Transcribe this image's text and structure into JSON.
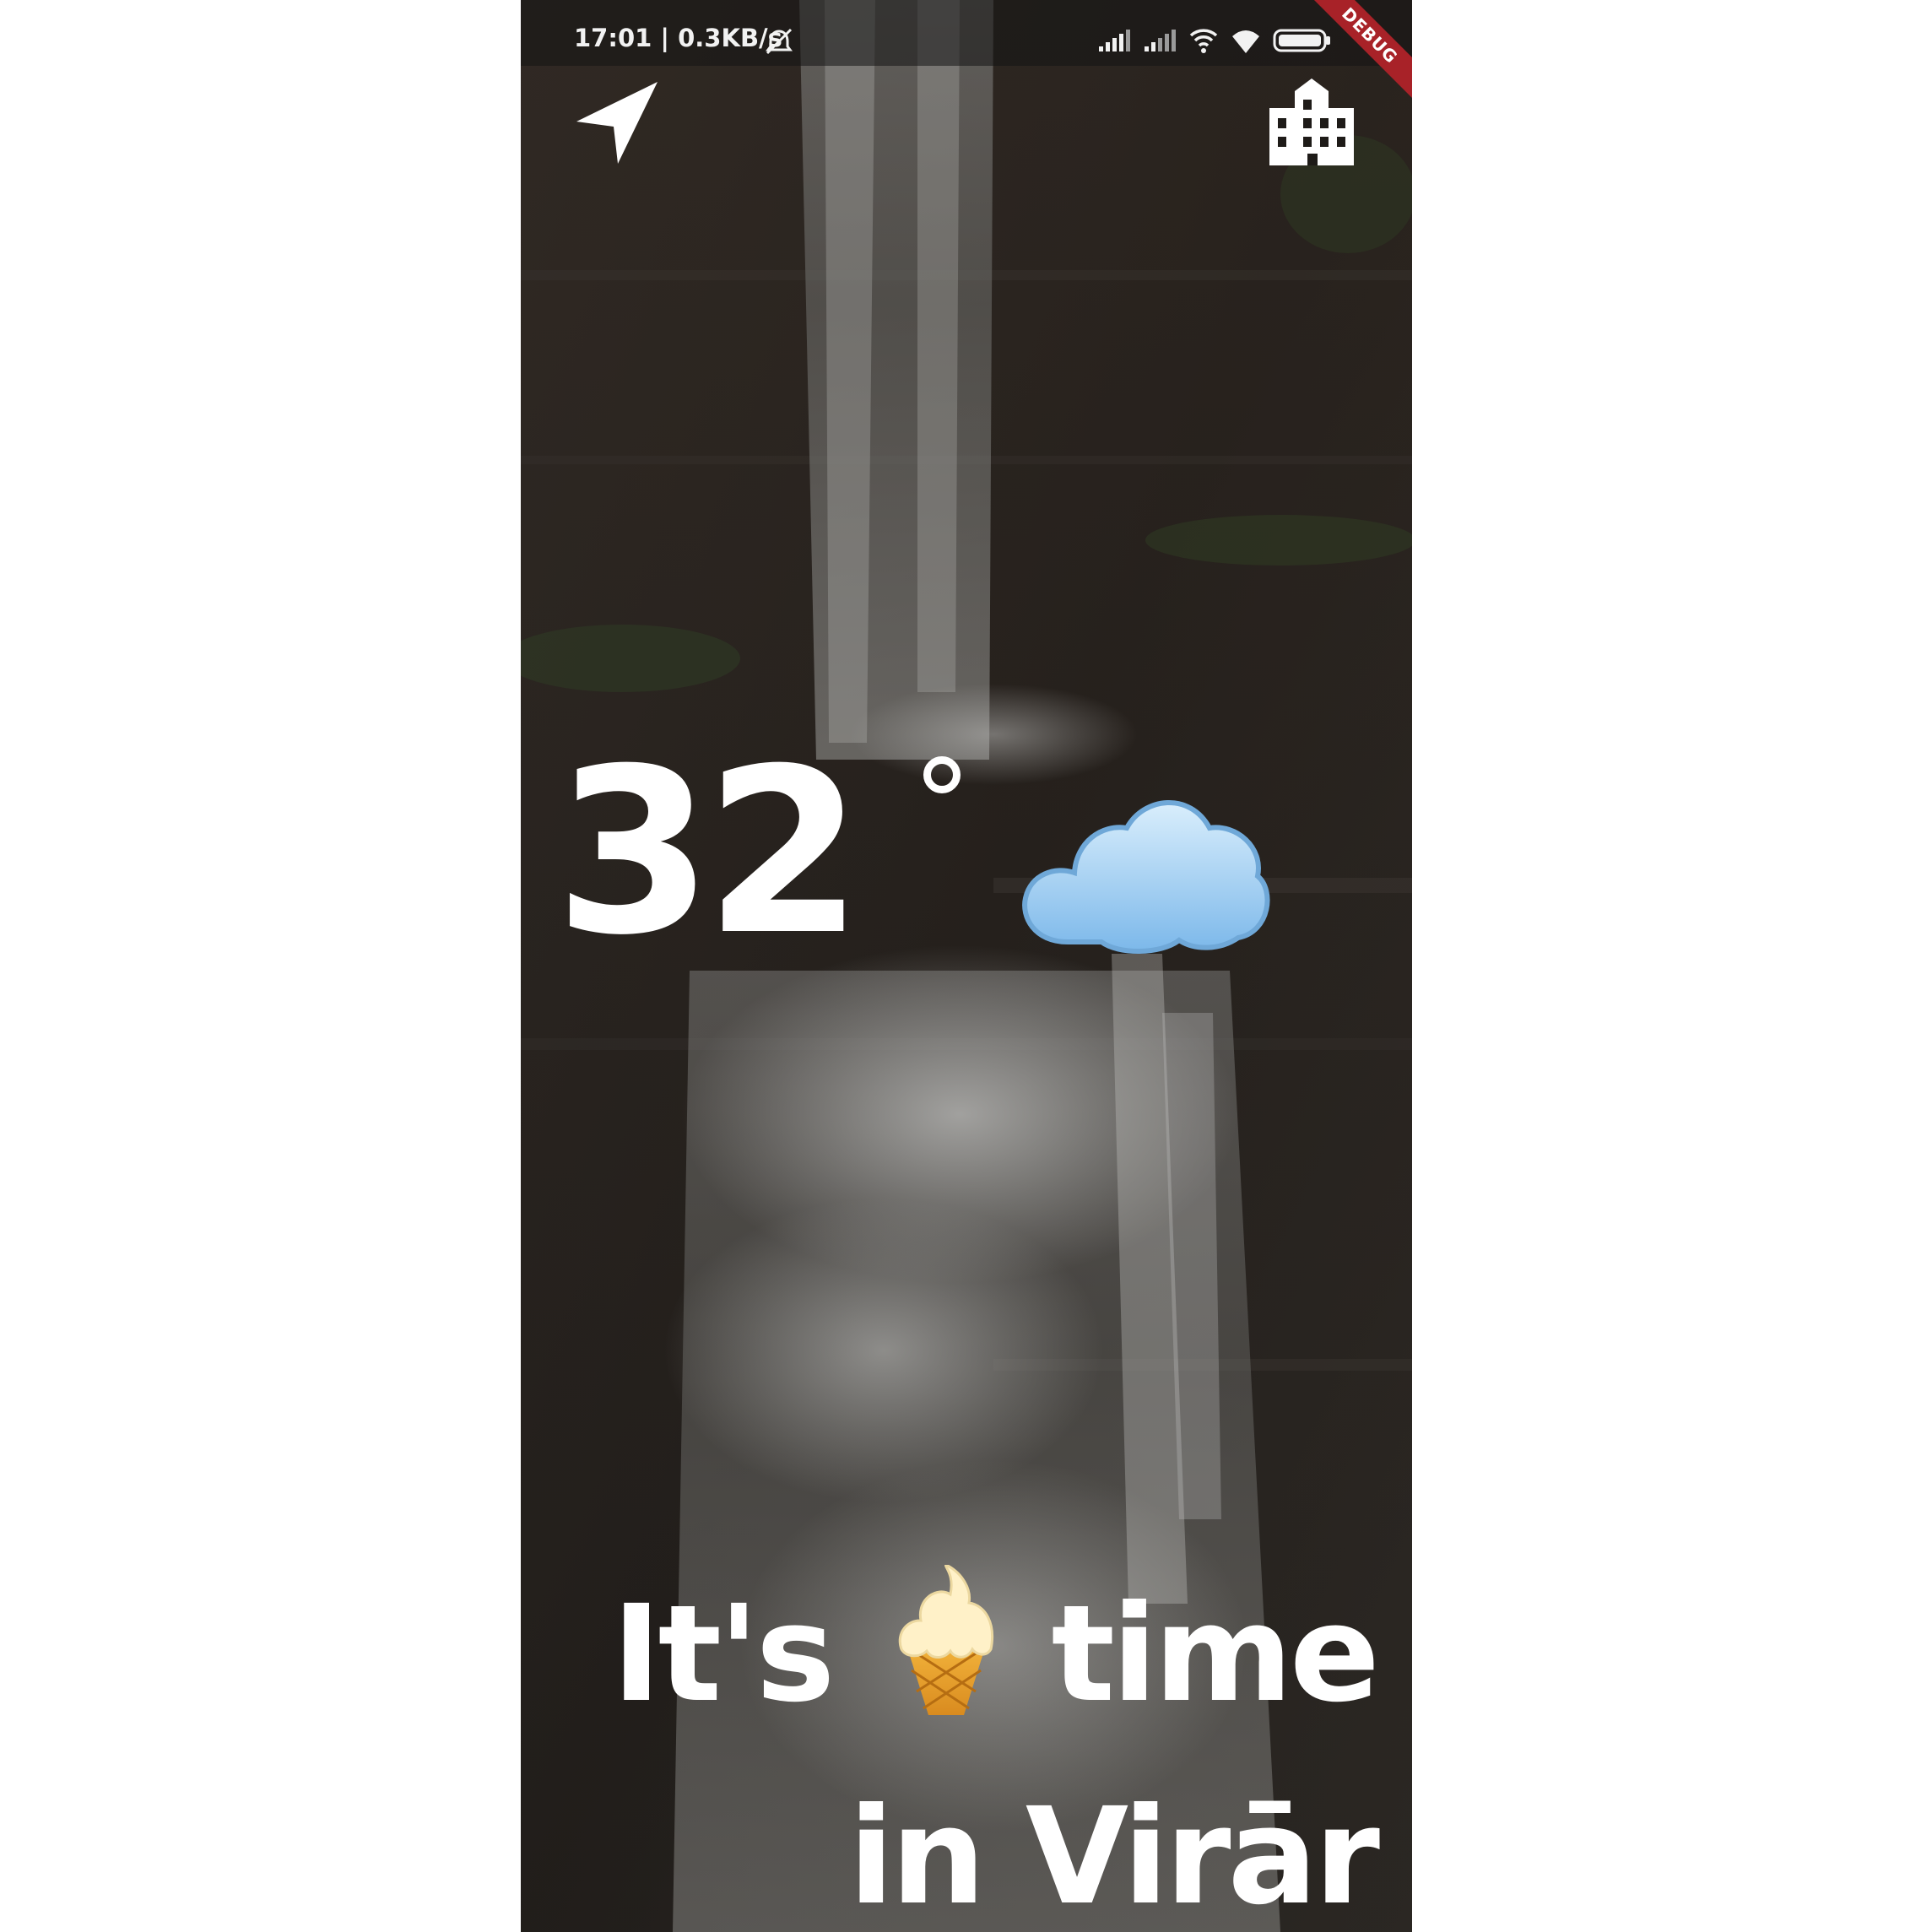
{
  "status_bar": {
    "time_speed": "17:01 | 0.3KB/s",
    "icons": [
      "alarm-off-icon",
      "signal-icon",
      "signal-icon",
      "wifi-icon",
      "wifi-icon",
      "battery-icon"
    ],
    "debug_banner": "DEBUG"
  },
  "toolbar": {
    "location_icon": "navigation-arrow-icon",
    "city_icon": "city-buildings-icon"
  },
  "weather": {
    "temperature": "32",
    "condition_icon": "cloud-icon"
  },
  "message": {
    "line1_prefix": "It's",
    "line1_icon": "ice-cream-icon",
    "line1_suffix": "time",
    "line2": "in Virār"
  },
  "colors": {
    "text": "#ffffff",
    "debug_banner": "#a82228",
    "cloud": "#9fd0f5"
  }
}
